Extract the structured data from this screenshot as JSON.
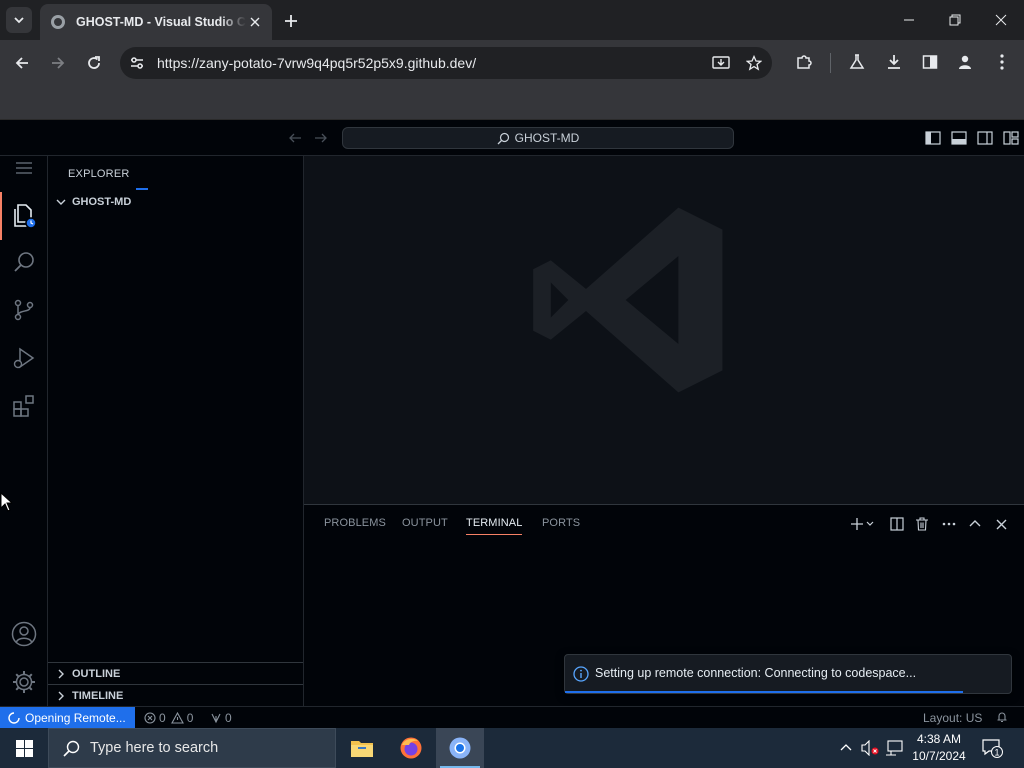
{
  "browser": {
    "tab_title": "GHOST-MD - Visual Studio Code",
    "url": "https://zany-potato-7vrw9q4pq5r52p5x9.github.dev/"
  },
  "vscode": {
    "command_center": "GHOST-MD",
    "sidebar": {
      "header": "EXPLORER",
      "folder": "GHOST-MD",
      "outline": "OUTLINE",
      "timeline": "TIMELINE"
    },
    "panel": {
      "tabs": [
        "PROBLEMS",
        "OUTPUT",
        "TERMINAL",
        "PORTS"
      ],
      "active_tab": "TERMINAL"
    },
    "notification": {
      "message": "Setting up remote connection: Connecting to codespace..."
    },
    "statusbar": {
      "remote": "Opening Remote...",
      "errors": "0",
      "warnings": "0",
      "ports": "0",
      "layout": "Layout: US"
    }
  },
  "taskbar": {
    "search_placeholder": "Type here to search",
    "time": "4:38 AM",
    "date": "10/7/2024",
    "notification_count": "1"
  },
  "colors": {
    "accent": "#1f6feb",
    "active_tab_indicator": "#f78166",
    "background": "#0d1117"
  }
}
